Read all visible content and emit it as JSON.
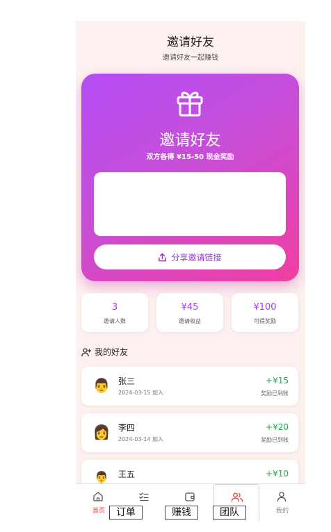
{
  "header": {
    "title": "邀请好友",
    "subtitle": "邀请好友一起赚钱"
  },
  "invite_card": {
    "title": "邀请好友",
    "subtitle": "双方各得 ¥15-50 现金奖励",
    "share_button": "分享邀请链接",
    "gradient": [
      "#b34df5",
      "#f03ea0"
    ]
  },
  "stats": [
    {
      "value": "3",
      "label": "邀请人数"
    },
    {
      "value": "¥45",
      "label": "邀请收益"
    },
    {
      "value": "¥100",
      "label": "可得奖励"
    }
  ],
  "friends": {
    "title": "我的好友",
    "items": [
      {
        "avatar": "👨",
        "name": "张三",
        "date": "2024-03-15 加入",
        "reward": "+¥15",
        "status": "奖励已到账"
      },
      {
        "avatar": "👩",
        "name": "李四",
        "date": "2024-03-14 加入",
        "reward": "+¥20",
        "status": "奖励已到账"
      },
      {
        "avatar": "👨‍💼",
        "name": "王五",
        "date": "",
        "reward": "+¥10",
        "status": ""
      }
    ]
  },
  "nav": {
    "items": [
      {
        "label": "首页",
        "icon": "home-icon"
      },
      {
        "label": "",
        "icon": "list-check-icon"
      },
      {
        "label": "",
        "icon": "wallet-icon"
      },
      {
        "label": "",
        "icon": "users-icon"
      },
      {
        "label": "我的",
        "icon": "user-icon"
      }
    ],
    "overlay_labels": [
      "订单",
      "赚钱",
      "团队"
    ]
  },
  "colors": {
    "accent": "#a23fe6",
    "reward_green": "#1bb04a",
    "nav_active": "#e8473c",
    "background": "#fdf1ef"
  }
}
